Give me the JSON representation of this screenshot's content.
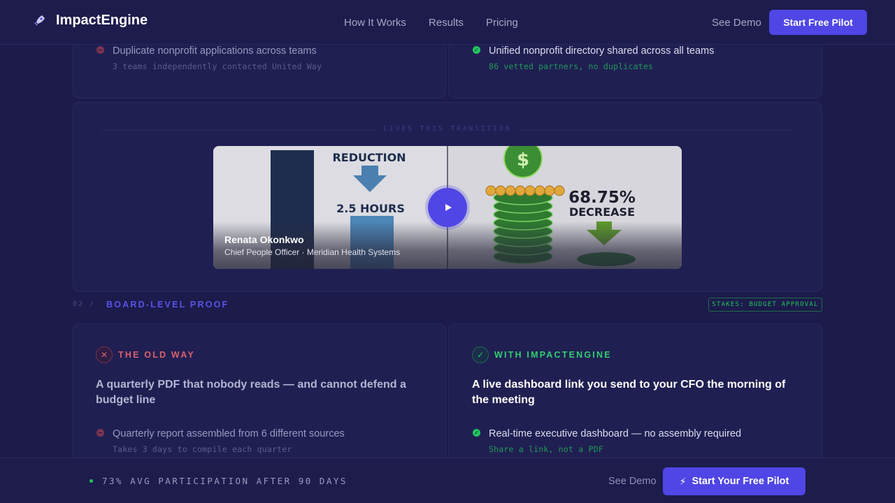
{
  "nav": {
    "brand_name": "ImpactEngine",
    "logo_icon": "rocket-icon",
    "links": [
      "How It Works",
      "Results",
      "Pricing"
    ],
    "see_demo": "See Demo",
    "cta": "Start Free Pilot"
  },
  "comparison_top": {
    "old": {
      "title": "Duplicate nonprofit applications across teams",
      "sub": "3 teams independently contacted United Way"
    },
    "new": {
      "title": "Unified nonprofit directory shared across all teams",
      "sub": "86 vetted partners, no duplicates"
    }
  },
  "video": {
    "label": "LIVES THIS TRANSITION",
    "presenter_name": "Renata Okonkwo",
    "presenter_role": "Chief People Officer · Meridian Health Systems",
    "thumbnail": {
      "left_top_text": "REDUCTION",
      "left_value": "2.5 HOURS",
      "right_value": "68.75%",
      "right_label": "DECREASE"
    },
    "play_icon": "play-icon"
  },
  "section": {
    "number": "02 /",
    "title": "BOARD-LEVEL PROOF",
    "stakes": "STAKES: BUDGET APPROVAL"
  },
  "proof": {
    "old": {
      "label": "THE OLD WAY",
      "icon": "x-icon",
      "headline": "A quarterly PDF that nobody reads — and cannot defend a budget line",
      "item_title": "Quarterly report assembled from 6 different sources",
      "item_sub": "Takes 3 days to compile each quarter"
    },
    "new": {
      "label": "WITH IMPACTENGINE",
      "icon": "check-icon",
      "headline": "A live dashboard link you send to your CFO the morning of the meeting",
      "item_title": "Real-time executive dashboard — no assembly required",
      "item_sub": "Share a link, not a PDF"
    }
  },
  "bottom_bar": {
    "stat": "73% AVG PARTICIPATION AFTER 90 DAYS",
    "see_demo": "See Demo",
    "cta": "Start Your Free Pilot"
  },
  "colors": {
    "background": "#1c1b4b",
    "accent": "#4f46e5",
    "good": "#22c55e",
    "bad": "#e05c6a"
  }
}
